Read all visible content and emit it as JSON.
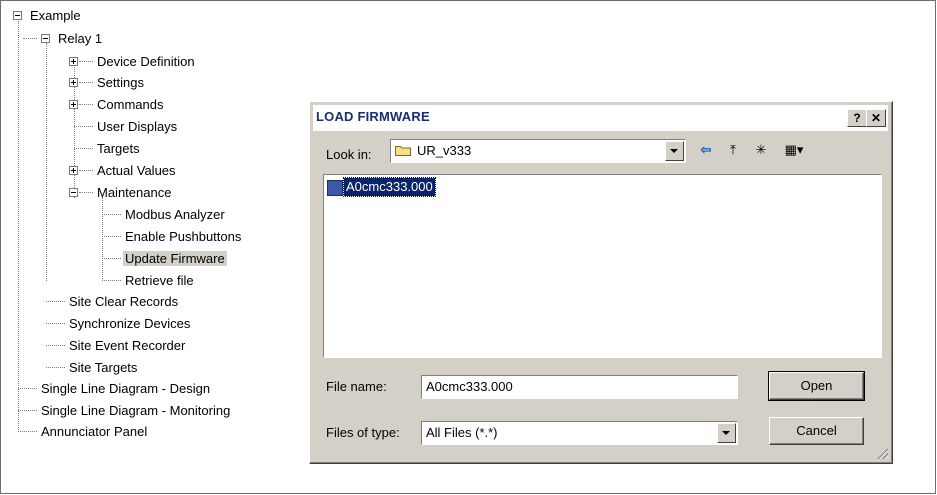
{
  "tree": {
    "items": [
      {
        "label": "Example"
      },
      {
        "label": "Relay 1"
      },
      {
        "label": "Device Definition"
      },
      {
        "label": "Settings"
      },
      {
        "label": "Commands"
      },
      {
        "label": "User Displays"
      },
      {
        "label": "Targets"
      },
      {
        "label": "Actual Values"
      },
      {
        "label": "Maintenance"
      },
      {
        "label": "Modbus Analyzer"
      },
      {
        "label": "Enable Pushbuttons"
      },
      {
        "label": "Update Firmware"
      },
      {
        "label": "Retrieve file"
      },
      {
        "label": "Site Clear Records"
      },
      {
        "label": "Synchronize Devices"
      },
      {
        "label": "Site Event Recorder"
      },
      {
        "label": "Site Targets"
      },
      {
        "label": "Single Line Diagram - Design"
      },
      {
        "label": "Single Line Diagram - Monitoring"
      },
      {
        "label": "Annunciator Panel"
      }
    ],
    "selected": "Update Firmware"
  },
  "dialog": {
    "title": "LOAD FIRMWARE",
    "help_label": "?",
    "close_label": "✕",
    "look_in_label": "Look in:",
    "look_in_value": "UR_v333",
    "tools": [
      {
        "icon": "back-arrow-icon",
        "glyph": "⇦"
      },
      {
        "icon": "up-folder-icon",
        "glyph": "⤒"
      },
      {
        "icon": "new-folder-icon",
        "glyph": "✳"
      },
      {
        "icon": "view-menu-icon",
        "glyph": "▦▾"
      }
    ],
    "files": [
      {
        "name": "A0cmc333.000"
      }
    ],
    "file_name_label": "File name:",
    "file_name_value": "A0cmc333.000",
    "files_of_type_label": "Files of type:",
    "files_of_type_value": "All Files (*.*)",
    "open_label": "Open",
    "cancel_label": "Cancel"
  }
}
